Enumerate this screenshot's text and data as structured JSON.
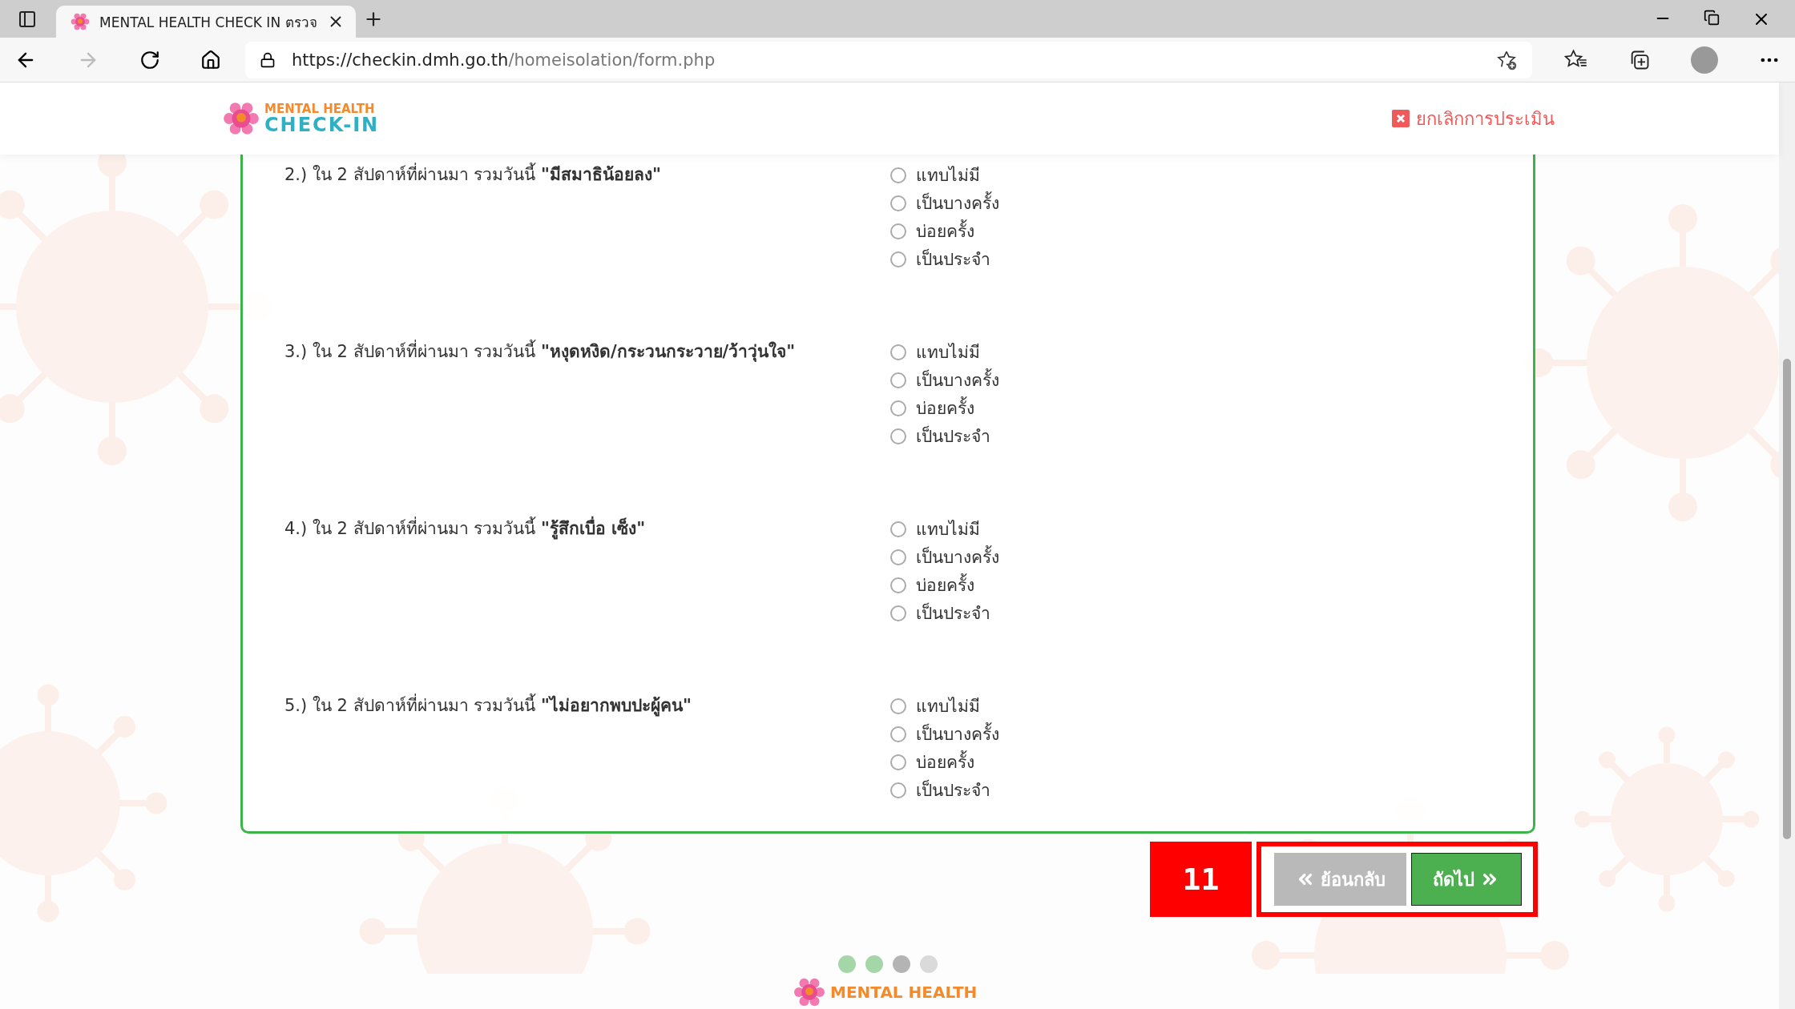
{
  "browser": {
    "tab_title": "MENTAL HEALTH CHECK IN ตรวจ",
    "url_host": "https://checkin.dmh.go.th",
    "url_path": "/homeisolation/form.php"
  },
  "header": {
    "logo_top": "MENTAL HEALTH",
    "logo_bottom": "CHECK-IN",
    "cancel": "ยกเลิกการประเมิน"
  },
  "questions": [
    {
      "text": "2.) ใน 2 สัปดาห์ที่ผ่านมา รวมวันนี้ **\"มีสมาธิน้อยลง\"**",
      "options": [
        {
          "label": "แทบไม่มี",
          "selected": false
        },
        {
          "label": "เป็นบางครั้ง",
          "selected": false
        },
        {
          "label": "บ่อยครั้ง",
          "selected": false
        },
        {
          "label": "เป็นประจำ",
          "selected": false
        }
      ]
    },
    {
      "text": "3.) ใน 2 สัปดาห์ที่ผ่านมา รวมวันนี้ **\"หงุดหงิด/กระวนกระวาย/ว้าวุ่นใจ\"**",
      "options": [
        {
          "label": "แทบไม่มี",
          "selected": false
        },
        {
          "label": "เป็นบางครั้ง",
          "selected": false
        },
        {
          "label": "บ่อยครั้ง",
          "selected": false
        },
        {
          "label": "เป็นประจำ",
          "selected": false
        }
      ]
    },
    {
      "text": "4.) ใน 2 สัปดาห์ที่ผ่านมา รวมวันนี้ **\"รู้สึกเบื่อ เซ็ง\"**",
      "options": [
        {
          "label": "แทบไม่มี",
          "selected": false
        },
        {
          "label": "เป็นบางครั้ง",
          "selected": false
        },
        {
          "label": "บ่อยครั้ง",
          "selected": false
        },
        {
          "label": "เป็นประจำ",
          "selected": false
        }
      ]
    },
    {
      "text": "5.) ใน 2 สัปดาห์ที่ผ่านมา รวมวันนี้ **\"ไม่อยากพบปะผู้คน\"**",
      "options": [
        {
          "label": "แทบไม่มี",
          "selected": false
        },
        {
          "label": "เป็นบางครั้ง",
          "selected": false
        },
        {
          "label": "บ่อยครั้ง",
          "selected": false
        },
        {
          "label": "เป็นประจำ",
          "selected": false
        }
      ]
    }
  ],
  "step_badge": "11",
  "buttons": {
    "back": "ย้อนกลับ",
    "next": "ถัดไป"
  },
  "progress_dots": [
    {
      "color": "#a5d6a7"
    },
    {
      "color": "#a5d6a7"
    },
    {
      "color": "#b4b4b4"
    },
    {
      "color": "#dadada"
    }
  ],
  "footer": {
    "logo_top": "MENTAL HEALTH"
  }
}
